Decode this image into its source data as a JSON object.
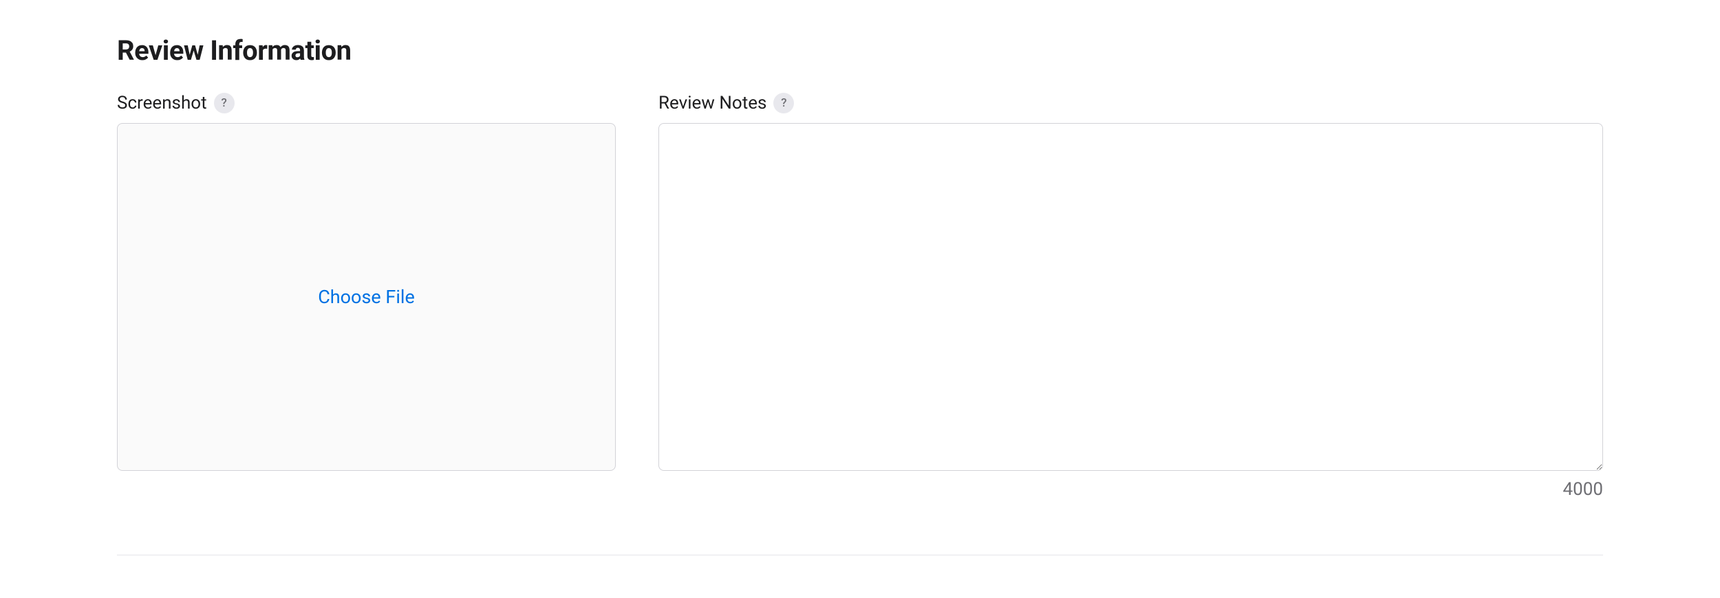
{
  "section": {
    "title": "Review Information"
  },
  "screenshot": {
    "label": "Screenshot",
    "help_char": "?",
    "choose_file_label": "Choose File"
  },
  "review_notes": {
    "label": "Review Notes",
    "help_char": "?",
    "value": "",
    "char_limit": "4000"
  }
}
